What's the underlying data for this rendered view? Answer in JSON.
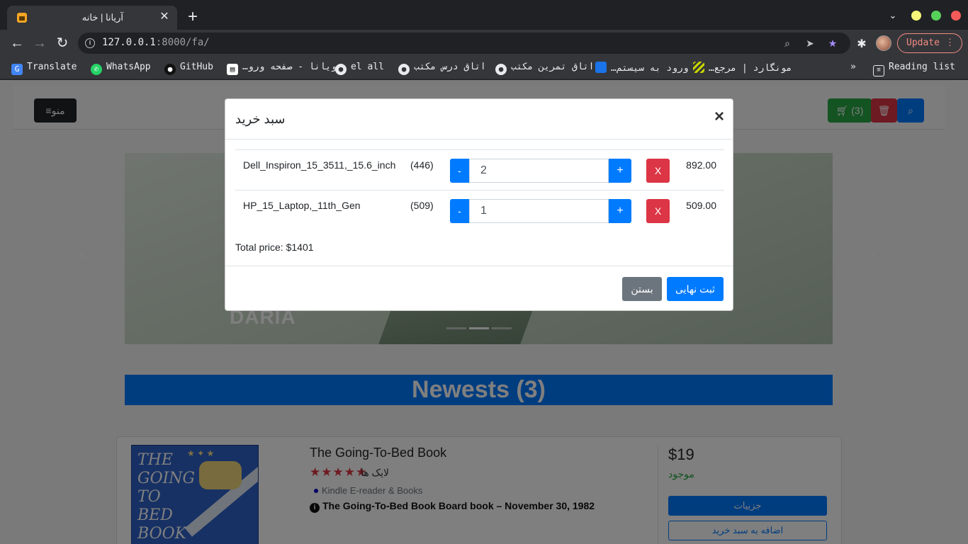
{
  "browser": {
    "tab_title": "آریانا | خانه",
    "tab_close": "✕",
    "new_tab": "+",
    "url_host": "127.0.0.1",
    "url_rest": ":8000/fa/",
    "update_label": "Update",
    "bookmarks": [
      {
        "label": "Translate",
        "icon": "google-translate-icon",
        "color": "#4285f4"
      },
      {
        "label": "WhatsApp",
        "icon": "whatsapp-icon",
        "color": "#25d366"
      },
      {
        "label": "GitHub",
        "icon": "github-icon",
        "color": "#24292e"
      },
      {
        "label": "ویانا - صفحه ورو…",
        "icon": "page-icon",
        "color": "#ffffff"
      },
      {
        "label": "el all",
        "icon": "person-icon",
        "color": "#e8eaed"
      },
      {
        "label": "اتاق درس مکتب",
        "icon": "person-icon",
        "color": "#e8eaed"
      },
      {
        "label": "اتاق تمرین مکتب",
        "icon": "person-icon",
        "color": "#e8eaed"
      },
      {
        "label": "ورود به سیستم…",
        "icon": "blue-logo-icon",
        "color": "#1a73e8"
      },
      {
        "label": "مونگارد | مرجع…",
        "icon": "stripes-icon",
        "color": "#c6d400"
      }
    ],
    "reading_list": "Reading list"
  },
  "site": {
    "menu_label": "منو",
    "cart_label": "(3)",
    "newest_label": "Newests (3)",
    "carousel_logo": "DARIA"
  },
  "product": {
    "title": "The Going-To-Bed Book",
    "likes": "لایک ها",
    "stars": "★★★★★",
    "category": "Kindle E-reader & Books",
    "subtitle": "The Going-To-Bed Book Board book – November 30, 1982",
    "price": "$19",
    "stock": "موجود",
    "details_btn": "جزییات",
    "add_to_cart_btn": "اضافه به سبد خرید",
    "cover_text": "THE GOING TO BED BOOK"
  },
  "cart_modal": {
    "title": "سبد خرید",
    "close_x": "×",
    "items": [
      {
        "name": "Dell_Inspiron_15_3511,_15.6_inch",
        "id": "(446)",
        "qty": "2",
        "total": "892.00"
      },
      {
        "name": "HP_15_Laptop,_11th_Gen",
        "id": "(509)",
        "qty": "1",
        "total": "509.00"
      }
    ],
    "minus": "-",
    "plus": "+",
    "remove": "X",
    "total_price": "Total price: $1401",
    "close_btn": "بستن",
    "submit_btn": "ثبت نهایی"
  },
  "colors": {
    "primary": "#007bff",
    "danger": "#dc3545",
    "success": "#28a745",
    "secondary": "#6c757d"
  }
}
